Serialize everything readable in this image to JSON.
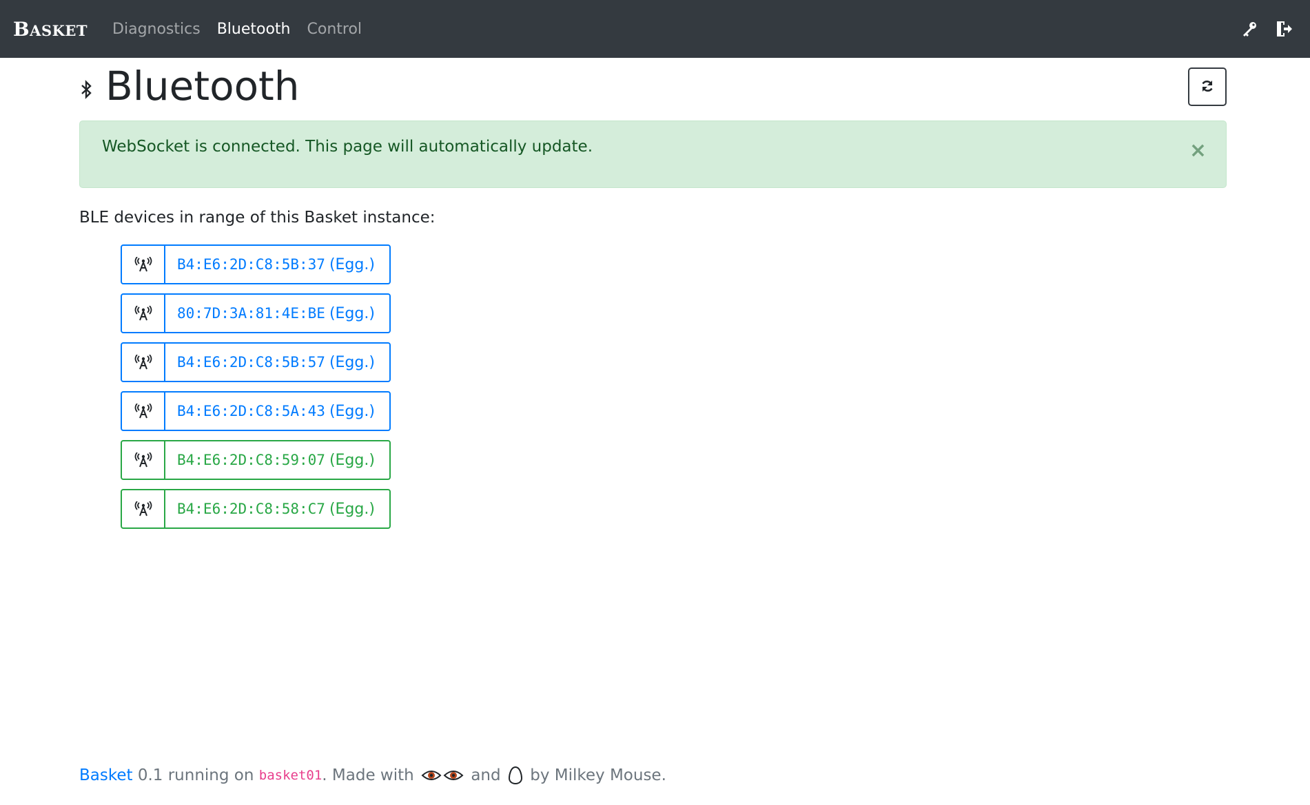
{
  "navbar": {
    "brand": {
      "initial": "B",
      "rest": "ASKET"
    },
    "links": [
      {
        "label": "Diagnostics",
        "active": false
      },
      {
        "label": "Bluetooth",
        "active": true
      },
      {
        "label": "Control",
        "active": false
      }
    ],
    "icons": [
      "key-icon",
      "sign-out-icon"
    ]
  },
  "page": {
    "title": "Bluetooth",
    "title_icon": "bluetooth-icon",
    "refresh_icon": "refresh-icon"
  },
  "alert": {
    "text": "WebSocket is connected. This page will automatically update.",
    "close": "×"
  },
  "intro": "BLE devices in range of this Basket instance:",
  "devices": [
    {
      "mac": "B4:E6:2D:C8:5B:37",
      "kind": "(Egg.)",
      "color": "#007bff"
    },
    {
      "mac": "80:7D:3A:81:4E:BE",
      "kind": "(Egg.)",
      "color": "#007bff"
    },
    {
      "mac": "B4:E6:2D:C8:5B:57",
      "kind": "(Egg.)",
      "color": "#007bff"
    },
    {
      "mac": "B4:E6:2D:C8:5A:43",
      "kind": "(Egg.)",
      "color": "#007bff"
    },
    {
      "mac": "B4:E6:2D:C8:59:07",
      "kind": "(Egg.)",
      "color": "#28a745"
    },
    {
      "mac": "B4:E6:2D:C8:58:C7",
      "kind": "(Egg.)",
      "color": "#28a745"
    }
  ],
  "footer": {
    "app_name": "Basket",
    "version_text": " 0.1 running on ",
    "host": "basket01",
    "made_with": ". Made with ",
    "and": " and ",
    "by": " by Milkey Mouse."
  }
}
